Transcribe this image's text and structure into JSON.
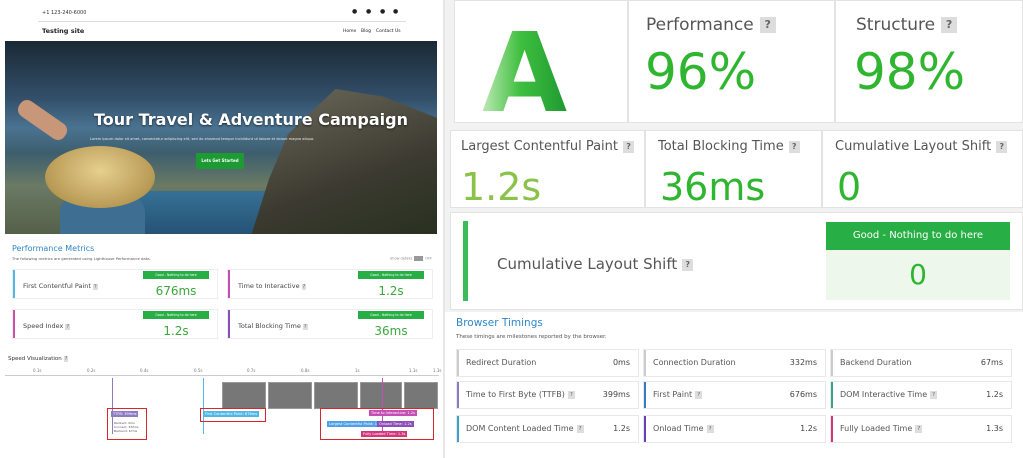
{
  "site": {
    "phone": "+1 123-240-6000",
    "name": "Testing site",
    "nav": [
      "Home",
      "Blog",
      "Contact Us"
    ],
    "hero_title": "Tour Travel & Adventure Campaign",
    "hero_subtitle": "Lorem ipsum dolor sit amet, consectetur adipiscing elit, sed do eiusmod tempor incididunt ut labore et dolore magna aliqua.",
    "hero_button": "Lets Get Started"
  },
  "perf_metrics": {
    "title": "Performance Metrics",
    "subtitle": "The following metrics are generated using Lighthouse Performance data.",
    "toggle_label": "Show details",
    "toggle_state": "OFF",
    "items": [
      {
        "label": "First Contentful Paint",
        "badge": "Good - Nothing to do here",
        "value": "676ms",
        "color": "#4fb8e6"
      },
      {
        "label": "Time to Interactive",
        "badge": "Good - Nothing to do here",
        "value": "1.2s",
        "color": "#c44fb4"
      },
      {
        "label": "Speed Index",
        "badge": "Good - Nothing to do here",
        "value": "1.2s",
        "color": "#d14fa8"
      },
      {
        "label": "Total Blocking Time",
        "badge": "Good - Nothing to do here",
        "value": "36ms",
        "color": "#8a4fb8"
      }
    ]
  },
  "speed_viz": {
    "title": "Speed Visualization",
    "ticks": [
      "0.1s",
      "0.2s",
      "0.4s",
      "0.5s",
      "0.7s",
      "0.8s",
      "1s",
      "1.1s",
      "1.3s"
    ],
    "markers": {
      "ttfb": "TTFB: 399ms",
      "ttfb_detail": [
        "Redirect: 0ms",
        "Connect: 332ms",
        "Backend: 67ms"
      ],
      "fcp": "First Contentful Paint: 676ms",
      "tti": "Time to Interactive: 1.2s",
      "lcp": "Largest Contentful Paint: 1.2s",
      "onload": "Onload Time: 1.2s",
      "fully": "Fully Loaded Time: 1.3s"
    }
  },
  "grade": {
    "letter": "A",
    "performance_label": "Performance",
    "performance_value": "96%",
    "structure_label": "Structure",
    "structure_value": "98%"
  },
  "web_vitals": [
    {
      "label": "Largest Contentful Paint",
      "value": "1.2s",
      "color": "#8bc34a"
    },
    {
      "label": "Total Blocking Time",
      "value": "36ms",
      "color": "#2fb52f"
    },
    {
      "label": "Cumulative Layout Shift",
      "value": "0",
      "color": "#2fb52f"
    }
  ],
  "cls_card": {
    "label": "Cumulative Layout Shift",
    "badge": "Good - Nothing to do here",
    "value": "0"
  },
  "browser_timings": {
    "title": "Browser Timings",
    "subtitle": "These timings are milestones reported by the browser.",
    "rows": [
      [
        {
          "label": "Redirect Duration",
          "value": "0ms",
          "color": "#cccccc"
        },
        {
          "label": "Connection Duration",
          "value": "332ms",
          "color": "#cccccc"
        },
        {
          "label": "Backend Duration",
          "value": "67ms",
          "color": "#cccccc"
        }
      ],
      [
        {
          "label": "Time to First Byte (TTFB)",
          "value": "399ms",
          "color": "#8e7cc3"
        },
        {
          "label": "First Paint",
          "value": "676ms",
          "color": "#3a7bbf"
        },
        {
          "label": "DOM Interactive Time",
          "value": "1.2s",
          "color": "#3aa48a"
        }
      ],
      [
        {
          "label": "DOM Content Loaded Time",
          "value": "1.2s",
          "color": "#3aa4c8"
        },
        {
          "label": "Onload Time",
          "value": "1.2s",
          "color": "#6a3fb5"
        },
        {
          "label": "Fully Loaded Time",
          "value": "1.3s",
          "color": "#d1357a"
        }
      ]
    ]
  }
}
